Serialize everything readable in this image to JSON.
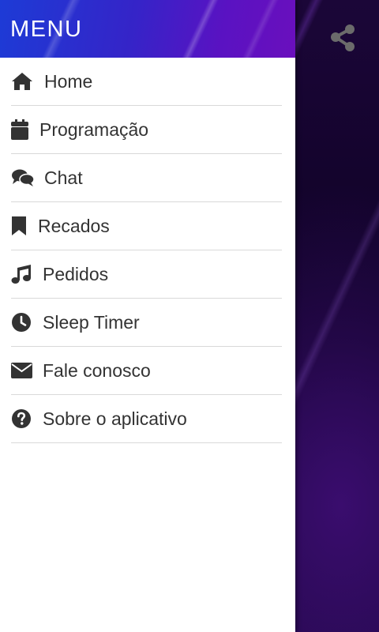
{
  "header": {
    "title": "MENU"
  },
  "menu": {
    "items": [
      {
        "label": "Home",
        "icon": "home-icon"
      },
      {
        "label": "Programação",
        "icon": "calendar-icon"
      },
      {
        "label": "Chat",
        "icon": "chat-icon"
      },
      {
        "label": "Recados",
        "icon": "bookmark-icon"
      },
      {
        "label": "Pedidos",
        "icon": "music-icon"
      },
      {
        "label": "Sleep Timer",
        "icon": "clock-icon"
      },
      {
        "label": "Fale conosco",
        "icon": "envelope-icon"
      },
      {
        "label": "Sobre o aplicativo",
        "icon": "question-circle-icon"
      }
    ]
  },
  "app": {
    "share_icon": "share-icon"
  },
  "colors": {
    "header_start": "#1d3bd6",
    "header_end": "#6a0fbd",
    "text": "#333333",
    "divider": "#d9d9d9",
    "icon": "#333333"
  }
}
